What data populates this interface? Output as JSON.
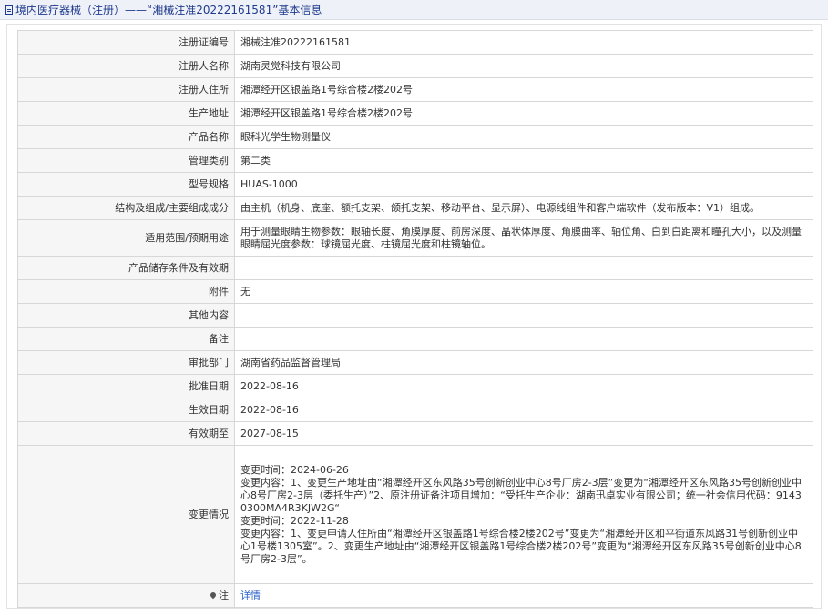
{
  "header": {
    "title": "境内医疗器械（注册）——“湘械注准20222161581”基本信息"
  },
  "rows": [
    {
      "label": "注册证编号",
      "value": "湘械注准20222161581"
    },
    {
      "label": "注册人名称",
      "value": "湖南灵觉科技有限公司"
    },
    {
      "label": "注册人住所",
      "value": "湘潭经开区银盖路1号综合楼2楼202号"
    },
    {
      "label": "生产地址",
      "value": "湘潭经开区银盖路1号综合楼2楼202号"
    },
    {
      "label": "产品名称",
      "value": "眼科光学生物测量仪"
    },
    {
      "label": "管理类别",
      "value": "第二类"
    },
    {
      "label": "型号规格",
      "value": "HUAS-1000"
    },
    {
      "label": "结构及组成/主要组成成分",
      "value": "由主机（机身、底座、额托支架、颌托支架、移动平台、显示屏）、电源线组件和客户端软件（发布版本：V1）组成。"
    },
    {
      "label": "适用范围/预期用途",
      "value": "用于测量眼睛生物参数：眼轴长度、角膜厚度、前房深度、晶状体厚度、角膜曲率、轴位角、白到白距离和瞳孔大小，以及测量眼睛屈光度参数：球镜屈光度、柱镜屈光度和柱镜轴位。"
    },
    {
      "label": "产品储存条件及有效期",
      "value": ""
    },
    {
      "label": "附件",
      "value": "无"
    },
    {
      "label": "其他内容",
      "value": ""
    },
    {
      "label": "备注",
      "value": ""
    },
    {
      "label": "审批部门",
      "value": "湖南省药品监督管理局"
    },
    {
      "label": "批准日期",
      "value": "2022-08-16"
    },
    {
      "label": "生效日期",
      "value": "2022-08-16"
    },
    {
      "label": "有效期至",
      "value": "2027-08-15"
    }
  ],
  "changes": {
    "label": "变更情况",
    "lines": [
      "变更时间：2024-06-26",
      "变更内容：1、变更生产地址由“湘潭经开区东风路35号创新创业中心8号厂房2-3层”变更为“湘潭经开区东风路35号创新创业中心8号厂房2-3层（委托生产）”2、原注册证备注项目增加：“受托生产企业：湖南迅卓实业有限公司；统一社会信用代码：91430300MA4R3KJW2G“",
      "变更时间：2022-11-28",
      "变更内容：1、变更申请人住所由“湘潭经开区银盖路1号综合楼2楼202号”变更为“湘潭经开区和平街道东风路31号创新创业中心1号楼1305室”。2、变更生产地址由“湘潭经开区银盖路1号综合楼2楼202号”变更为“湘潭经开区东风路35号创新创业中心8号厂房2-3层”。"
    ]
  },
  "note_row": {
    "label": "注",
    "link": "详情"
  }
}
